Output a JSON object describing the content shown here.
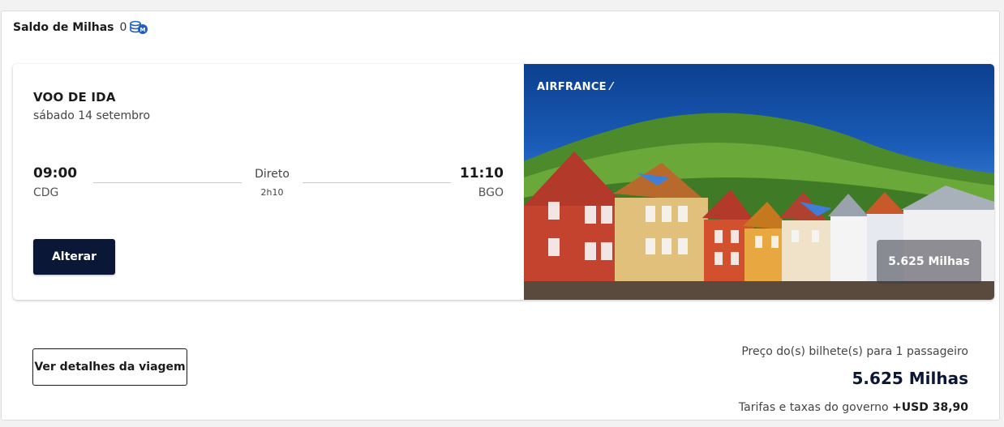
{
  "balance": {
    "label": "Saldo de Milhas",
    "value": "0"
  },
  "leg": {
    "title": "VOO DE IDA",
    "date": "sábado 14 setembro",
    "departure": {
      "time": "09:00",
      "code": "CDG"
    },
    "arrival": {
      "time": "11:10",
      "code": "BGO"
    },
    "stops": "Direto",
    "duration": "2h10",
    "change_label": "Alterar"
  },
  "promo": {
    "airline": "AIRFRANCE",
    "price": "5.625 Milhas"
  },
  "summary": {
    "details_label": "Ver detalhes da viagem",
    "caption": "Preço do(s) bilhete(s) para 1 passageiro",
    "total": "5.625 Milhas",
    "taxes_label": "Tarifas e taxas do governo",
    "taxes_value": "+USD 38,90"
  },
  "colors": {
    "navy": "#0a1737",
    "accent_blue": "#1f5fc4"
  }
}
